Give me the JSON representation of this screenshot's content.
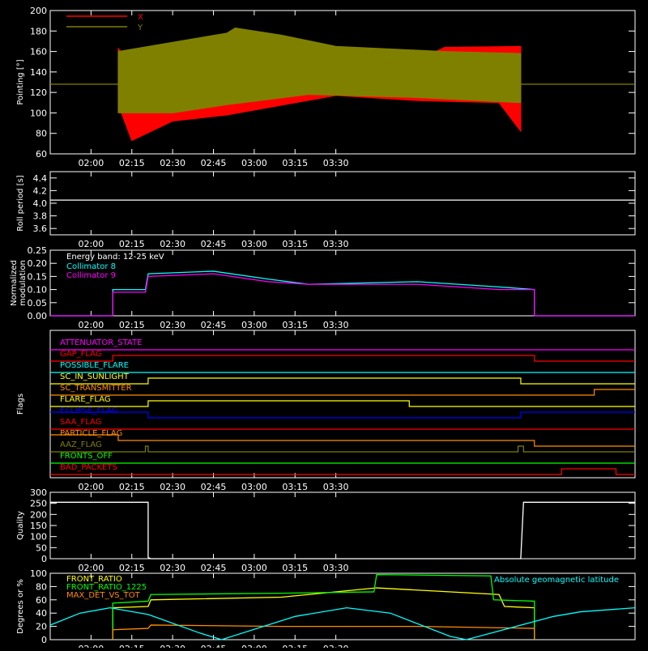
{
  "chart_data": [
    {
      "type": "line",
      "ylabel": "Pointing [°]",
      "ylim": [
        60,
        200
      ],
      "yticks": [
        "60",
        "80",
        "100",
        "120",
        "140",
        "160",
        "180",
        "200"
      ],
      "legend": [
        {
          "name": "X",
          "color": "#ff0000"
        },
        {
          "name": "Y",
          "color": "#808000"
        }
      ],
      "series": [
        {
          "name": "X",
          "color": "#ff0000",
          "envelope_upper": [
            [
              130,
              163
            ],
            [
              135,
              148
            ],
            [
              145,
              120
            ],
            [
              165,
              125
            ],
            [
              205,
              126
            ],
            [
              230,
              140
            ],
            [
              250,
              164
            ],
            [
              278,
              165
            ]
          ],
          "envelope_lower": [
            [
              130,
              108
            ],
            [
              135,
              73
            ],
            [
              150,
              92
            ],
            [
              170,
              98
            ],
            [
              210,
              117
            ],
            [
              240,
              112
            ],
            [
              270,
              110
            ],
            [
              278,
              82
            ]
          ]
        },
        {
          "name": "Y",
          "color": "#808000",
          "envelope_upper": [
            [
              130,
              160
            ],
            [
              170,
              178
            ],
            [
              173,
              183
            ],
            [
              190,
              176
            ],
            [
              210,
              165
            ],
            [
              250,
              160
            ],
            [
              278,
              158
            ]
          ],
          "envelope_lower": [
            [
              130,
              100
            ],
            [
              150,
              100
            ],
            [
              170,
              108
            ],
            [
              200,
              118
            ],
            [
              240,
              115
            ],
            [
              278,
              110
            ]
          ]
        },
        {
          "name": "Y level",
          "color": "#808000",
          "values": [
            [
              105,
              128
            ],
            [
              320,
              128
            ]
          ]
        }
      ]
    },
    {
      "type": "line",
      "ylabel": "Roll period [s]",
      "ylim": [
        3.5,
        4.5
      ],
      "yticks": [
        "3.6",
        "3.8",
        "4.0",
        "4.2",
        "4.4"
      ],
      "series": [
        {
          "name": "Roll period",
          "color": "#ffffff",
          "values": [
            [
              105,
              4.05
            ],
            [
              320,
              4.05
            ]
          ]
        }
      ]
    },
    {
      "type": "line",
      "ylabel": "Normalized modulation",
      "ylim": [
        0,
        0.25
      ],
      "yticks": [
        "0.00",
        "0.05",
        "0.10",
        "0.15",
        "0.20",
        "0.25"
      ],
      "annotation": "Energy band: 12-25 keV",
      "legend": [
        {
          "name": "Collimator 8",
          "color": "#00ffff"
        },
        {
          "name": "Collimator 9",
          "color": "#ff00ff"
        }
      ],
      "series": [
        {
          "name": "Collimator 8",
          "color": "#00ffff",
          "values": [
            [
              105,
              0
            ],
            [
              128,
              0
            ],
            [
              128,
              0.1
            ],
            [
              140,
              0.1
            ],
            [
              141,
              0.16
            ],
            [
              165,
              0.17
            ],
            [
              185,
              0.14
            ],
            [
              200,
              0.12
            ],
            [
              240,
              0.13
            ],
            [
              270,
              0.11
            ],
            [
              283,
              0.1
            ],
            [
              283,
              0
            ],
            [
              320,
              0
            ]
          ]
        },
        {
          "name": "Collimator 9",
          "color": "#ff00ff",
          "values": [
            [
              105,
              0
            ],
            [
              128,
              0
            ],
            [
              128,
              0.09
            ],
            [
              140,
              0.09
            ],
            [
              141,
              0.15
            ],
            [
              165,
              0.16
            ],
            [
              185,
              0.13
            ],
            [
              200,
              0.12
            ],
            [
              240,
              0.12
            ],
            [
              270,
              0.1
            ],
            [
              283,
              0.1
            ],
            [
              283,
              0
            ],
            [
              320,
              0
            ]
          ]
        }
      ]
    },
    {
      "type": "line",
      "ylabel": "Flags",
      "flags": [
        {
          "name": "ATTENUATOR_STATE",
          "color": "#ff00ff",
          "segments": [
            [
              105,
              0
            ],
            [
              320,
              0
            ]
          ]
        },
        {
          "name": "GAP_FLAG",
          "color": "#ff0000",
          "segments": [
            [
              105,
              0
            ],
            [
              128,
              0
            ],
            [
              128,
              1
            ],
            [
              283,
              1
            ],
            [
              283,
              0
            ],
            [
              320,
              0
            ]
          ]
        },
        {
          "name": "POSSIBLE_FLARE",
          "color": "#00ffff",
          "segments": [
            [
              105,
              0
            ],
            [
              320,
              0
            ]
          ]
        },
        {
          "name": "SC_IN_SUNLIGHT",
          "color": "#ffff00",
          "segments": [
            [
              105,
              0
            ],
            [
              141,
              0
            ],
            [
              141,
              1
            ],
            [
              278,
              1
            ],
            [
              278,
              0
            ],
            [
              320,
              0
            ]
          ]
        },
        {
          "name": "SC_TRANSMITTER",
          "color": "#ff8c00",
          "segments": [
            [
              105,
              0
            ],
            [
              305,
              0
            ],
            [
              305,
              1
            ],
            [
              320,
              1
            ]
          ]
        },
        {
          "name": "FLARE_FLAG",
          "color": "#ffff00",
          "segments": [
            [
              105,
              0
            ],
            [
              141,
              0
            ],
            [
              141,
              1
            ],
            [
              237,
              1
            ],
            [
              237,
              0
            ],
            [
              320,
              0
            ]
          ]
        },
        {
          "name": "ECLIPSE_FLAG",
          "color": "#0000ff",
          "segments": [
            [
              105,
              1
            ],
            [
              141,
              1
            ],
            [
              141,
              0
            ],
            [
              278,
              0
            ],
            [
              278,
              1
            ],
            [
              320,
              1
            ]
          ]
        },
        {
          "name": "SAA_FLAG",
          "color": "#ff0000",
          "segments": [
            [
              105,
              0
            ],
            [
              320,
              0
            ]
          ]
        },
        {
          "name": "PARTICLE_FLAG",
          "color": "#ff8c00",
          "segments": [
            [
              105,
              1
            ],
            [
              130,
              1
            ],
            [
              130,
              0
            ],
            [
              283,
              0
            ],
            [
              283,
              -1
            ],
            [
              320,
              -1
            ]
          ]
        },
        {
          "name": "AAZ_FLAG",
          "color": "#808000",
          "segments": [
            [
              105,
              0
            ],
            [
              140,
              0
            ],
            [
              140,
              1
            ],
            [
              141,
              1
            ],
            [
              141,
              0
            ],
            [
              277,
              0
            ],
            [
              277,
              1
            ],
            [
              279,
              1
            ],
            [
              279,
              0
            ],
            [
              320,
              0
            ]
          ]
        },
        {
          "name": "FRONTS_OFF",
          "color": "#00ff00",
          "segments": [
            [
              105,
              0
            ],
            [
              320,
              0
            ]
          ]
        },
        {
          "name": "BAD_PACKETS",
          "color": "#ff0000",
          "segments": [
            [
              105,
              0
            ],
            [
              293,
              0
            ],
            [
              293,
              1
            ],
            [
              313,
              1
            ],
            [
              313,
              0
            ],
            [
              320,
              0
            ]
          ]
        }
      ]
    },
    {
      "type": "line",
      "ylabel": "Quality",
      "ylim": [
        0,
        300
      ],
      "yticks": [
        "0",
        "50",
        "100",
        "150",
        "200",
        "250",
        "300"
      ],
      "series": [
        {
          "name": "Quality",
          "color": "#ffffff",
          "values": [
            [
              105,
              255
            ],
            [
              141,
              255
            ],
            [
              141,
              5
            ],
            [
              142,
              0
            ],
            [
              278,
              0
            ],
            [
              278,
              5
            ],
            [
              279,
              255
            ],
            [
              320,
              255
            ]
          ]
        }
      ]
    },
    {
      "type": "line",
      "ylabel": "Degrees or %",
      "ylim": [
        0,
        100
      ],
      "yticks": [
        "0",
        "20",
        "40",
        "60",
        "80",
        "100"
      ],
      "legend": [
        {
          "name": "FRONT_RATIO",
          "color": "#ffff00"
        },
        {
          "name": "FRONT_RATIO_1225",
          "color": "#00ff00"
        },
        {
          "name": "MAX_DET_VS_TOT",
          "color": "#ff8c00"
        },
        {
          "name": "Absolute geomagnetic latitude",
          "color": "#00ffff"
        }
      ],
      "series": [
        {
          "name": "FRONT_RATIO",
          "color": "#ffff00",
          "values": [
            [
              128,
              0
            ],
            [
              128,
              48
            ],
            [
              141,
              50
            ],
            [
              142,
              60
            ],
            [
              190,
              64
            ],
            [
              225,
              78
            ],
            [
              270,
              68
            ],
            [
              272,
              50
            ],
            [
              283,
              48
            ],
            [
              283,
              0
            ]
          ]
        },
        {
          "name": "FRONT_RATIO_1225",
          "color": "#00ff00",
          "values": [
            [
              128,
              0
            ],
            [
              128,
              55
            ],
            [
              141,
              58
            ],
            [
              142,
              68
            ],
            [
              190,
              70
            ],
            [
              224,
              72
            ],
            [
              225,
              98
            ],
            [
              267,
              96
            ],
            [
              268,
              60
            ],
            [
              283,
              58
            ],
            [
              283,
              0
            ]
          ]
        },
        {
          "name": "MAX_DET_VS_TOT",
          "color": "#ff8c00",
          "values": [
            [
              128,
              0
            ],
            [
              128,
              15
            ],
            [
              141,
              17
            ],
            [
              142,
              22
            ],
            [
              190,
              20
            ],
            [
              240,
              20
            ],
            [
              283,
              17
            ],
            [
              283,
              0
            ]
          ]
        },
        {
          "name": "Absolute geomagnetic latitude",
          "color": "#00ffff",
          "values": [
            [
              105,
              22
            ],
            [
              116,
              40
            ],
            [
              127,
              48
            ],
            [
              141,
              38
            ],
            [
              160,
              10
            ],
            [
              168,
              0
            ],
            [
              195,
              35
            ],
            [
              214,
              48
            ],
            [
              230,
              40
            ],
            [
              252,
              5
            ],
            [
              258,
              0
            ],
            [
              290,
              35
            ],
            [
              300,
              42
            ],
            [
              320,
              48
            ]
          ]
        }
      ]
    }
  ],
  "x_axis": {
    "xlim": [
      105,
      320
    ],
    "ticks": [
      {
        "v": 120,
        "label": "02:00"
      },
      {
        "v": 135,
        "label": "02:15"
      },
      {
        "v": 150,
        "label": "02:30"
      },
      {
        "v": 165,
        "label": "02:45"
      },
      {
        "v": 180,
        "label": "03:00"
      },
      {
        "v": 195,
        "label": "03:15"
      },
      {
        "v": 210,
        "label": "03:30"
      }
    ]
  }
}
